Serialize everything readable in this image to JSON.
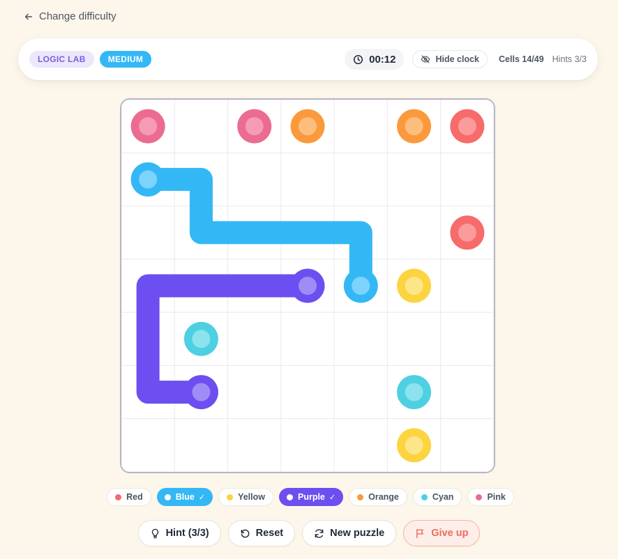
{
  "nav": {
    "back_label": "Change difficulty"
  },
  "header": {
    "brand": "LOGIC LAB",
    "level": "MEDIUM",
    "timer": "00:12",
    "hide_clock_label": "Hide clock",
    "cells": "Cells 14/49",
    "hints": "Hints 3/3"
  },
  "board": {
    "rows": 7,
    "cols": 7,
    "dots": [
      {
        "color": "pink",
        "row": 0,
        "col": 0
      },
      {
        "color": "pink",
        "row": 0,
        "col": 2
      },
      {
        "color": "orange",
        "row": 0,
        "col": 3
      },
      {
        "color": "orange",
        "row": 0,
        "col": 5
      },
      {
        "color": "red",
        "row": 0,
        "col": 6
      },
      {
        "color": "blue",
        "row": 1,
        "col": 0
      },
      {
        "color": "red",
        "row": 2,
        "col": 6
      },
      {
        "color": "purple",
        "row": 3,
        "col": 3
      },
      {
        "color": "blue",
        "row": 3,
        "col": 4
      },
      {
        "color": "yellow",
        "row": 3,
        "col": 5
      },
      {
        "color": "cyan",
        "row": 4,
        "col": 1
      },
      {
        "color": "purple",
        "row": 5,
        "col": 1
      },
      {
        "color": "cyan",
        "row": 5,
        "col": 5
      },
      {
        "color": "yellow",
        "row": 6,
        "col": 5
      }
    ],
    "paths": [
      {
        "color": "blue",
        "cells": [
          [
            1,
            0
          ],
          [
            1,
            1
          ],
          [
            2,
            1
          ],
          [
            2,
            2
          ],
          [
            2,
            3
          ],
          [
            2,
            4
          ],
          [
            3,
            4
          ]
        ]
      },
      {
        "color": "purple",
        "cells": [
          [
            3,
            3
          ],
          [
            3,
            2
          ],
          [
            3,
            1
          ],
          [
            3,
            0
          ],
          [
            4,
            0
          ],
          [
            5,
            0
          ],
          [
            5,
            1
          ]
        ]
      }
    ]
  },
  "palette": {
    "red": {
      "outer": "#f76b6b",
      "inner": "#fb9b9b"
    },
    "blue": {
      "outer": "#33b8f5",
      "inner": "#7dd3fb"
    },
    "yellow": {
      "outer": "#fcd440",
      "inner": "#fde68a"
    },
    "purple": {
      "outer": "#6d4ef0",
      "inner": "#a08cf6"
    },
    "orange": {
      "outer": "#fb9a3c",
      "inner": "#fdbd7d"
    },
    "cyan": {
      "outer": "#4dd0e1",
      "inner": "#8be3ee"
    },
    "pink": {
      "outer": "#ec6b90",
      "inner": "#f59bb6"
    }
  },
  "legend": [
    {
      "label": "Red",
      "color": "#f76b6b",
      "done": false
    },
    {
      "label": "Blue",
      "color": "#33b8f5",
      "done": true
    },
    {
      "label": "Yellow",
      "color": "#fcd440",
      "done": false
    },
    {
      "label": "Purple",
      "color": "#6d4ef0",
      "done": true
    },
    {
      "label": "Orange",
      "color": "#fb9a3c",
      "done": false
    },
    {
      "label": "Cyan",
      "color": "#4dd0e1",
      "done": false
    },
    {
      "label": "Pink",
      "color": "#ec6b90",
      "done": false
    }
  ],
  "actions": {
    "hint": "Hint (3/3)",
    "reset": "Reset",
    "new_puzzle": "New puzzle",
    "give_up": "Give up"
  }
}
